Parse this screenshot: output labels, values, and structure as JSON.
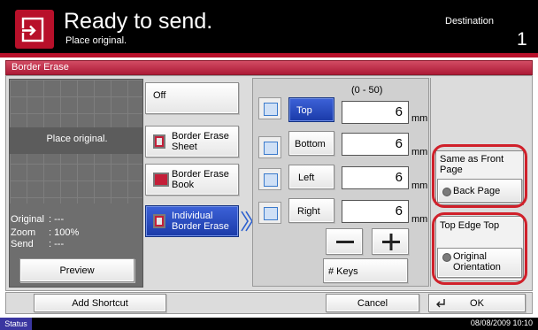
{
  "header": {
    "title": "Ready to send.",
    "subtitle": "Place original.",
    "destination_label": "Destination",
    "destination_count": "1"
  },
  "section": {
    "title": "Border Erase"
  },
  "preview": {
    "placeholder": "Place original.",
    "info": [
      {
        "key": "Original",
        "value": ": ---"
      },
      {
        "key": "Zoom",
        "value": ": 100%"
      },
      {
        "key": "Send",
        "value": ": ---"
      }
    ],
    "preview_label": "Preview"
  },
  "modes": {
    "off": "Off",
    "sheet": "Border Erase Sheet",
    "book": "Border Erase Book",
    "individual": "Individual Border Erase",
    "selected": "individual"
  },
  "sides": {
    "range": "(0 - 50)",
    "unit": "mm",
    "items": [
      {
        "label": "Top",
        "value": "6",
        "selected": true
      },
      {
        "label": "Bottom",
        "value": "6",
        "selected": false
      },
      {
        "label": "Left",
        "value": "6",
        "selected": false
      },
      {
        "label": "Right",
        "value": "6",
        "selected": false
      }
    ],
    "minus_icon": "minus-icon",
    "plus_icon": "plus-icon",
    "keys_label": "# Keys"
  },
  "back_page": {
    "same_as_label": "Same as Front Page",
    "back_page_label": "Back Page",
    "top_edge_label": "Top Edge Top",
    "original_orientation_label": "Original Orientation"
  },
  "footer": {
    "add_shortcut": "Add Shortcut",
    "cancel": "Cancel",
    "ok": "OK"
  },
  "statusbar": {
    "status_label": "Status",
    "datetime": "08/08/2009   10:10"
  },
  "colors": {
    "accent_red": "#b8102a",
    "selected_blue": "#1a3aa8",
    "highlight_oval": "#d0202a"
  }
}
